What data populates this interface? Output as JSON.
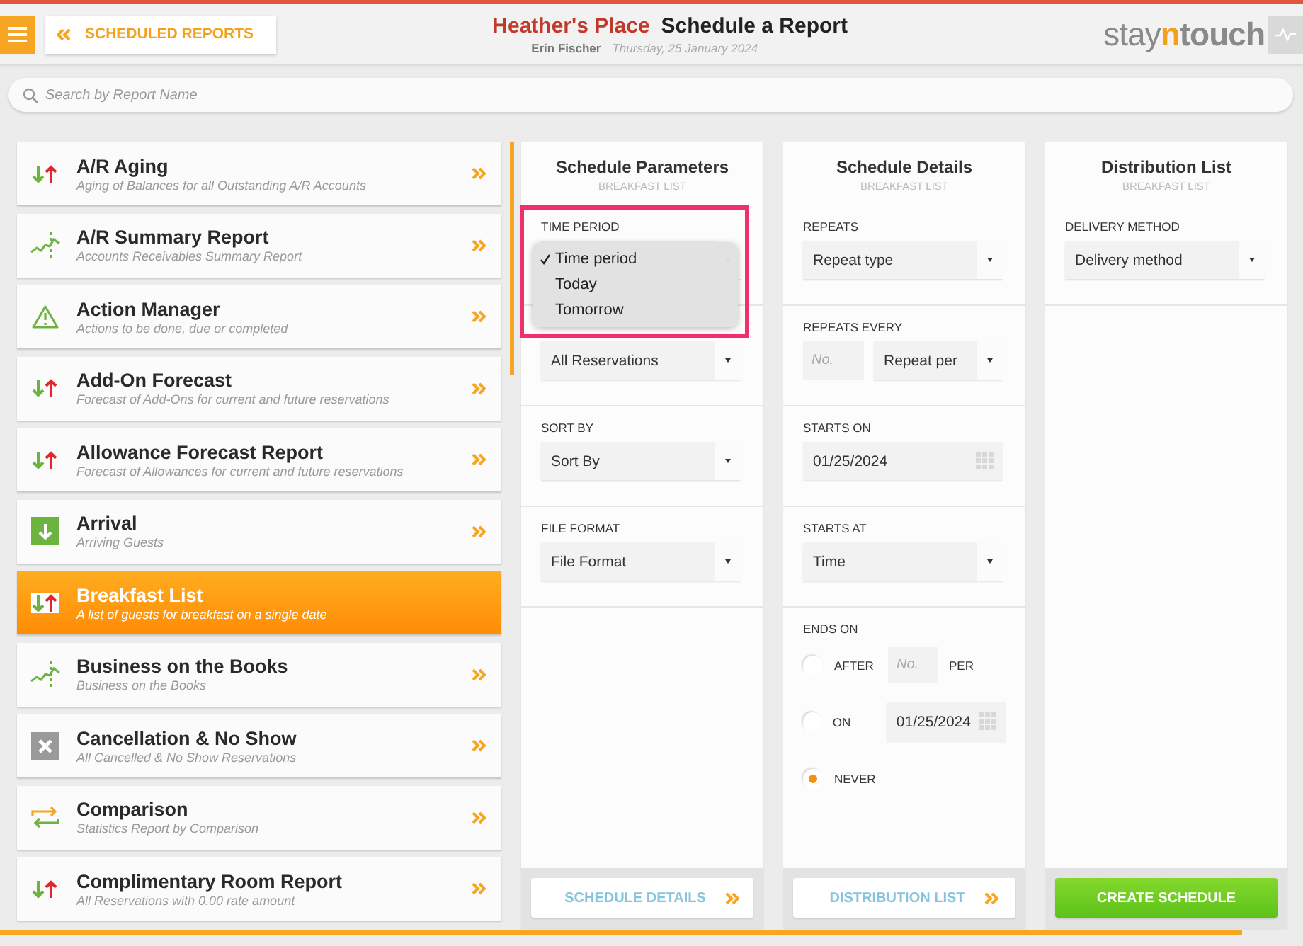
{
  "header": {
    "back_button": "SCHEDULED REPORTS",
    "hotel": "Heather's Place",
    "title": "Schedule a Report",
    "user": "Erin Fischer",
    "date": "Thursday, 25 January 2024",
    "logo": [
      "stay",
      "n",
      "touch"
    ]
  },
  "search": {
    "placeholder": "Search by Report Name"
  },
  "reports": [
    {
      "title": "A/R Aging",
      "subtitle": "Aging of Balances for all Outstanding A/R Accounts",
      "kind": "updown",
      "selected": false
    },
    {
      "title": "A/R Summary Report",
      "subtitle": "Accounts Receivables Summary Report",
      "kind": "trend",
      "selected": false
    },
    {
      "title": "Action Manager",
      "subtitle": "Actions to be done, due or completed",
      "kind": "warning",
      "selected": false
    },
    {
      "title": "Add-On Forecast",
      "subtitle": "Forecast of Add-Ons for current and future reservations",
      "kind": "updown",
      "selected": false
    },
    {
      "title": "Allowance Forecast Report",
      "subtitle": "Forecast of Allowances for current and future reservations",
      "kind": "updown",
      "selected": false
    },
    {
      "title": "Arrival",
      "subtitle": "Arriving Guests",
      "kind": "arrival",
      "selected": false
    },
    {
      "title": "Breakfast List",
      "subtitle": "A list of guests for breakfast on a single date",
      "kind": "updown",
      "selected": true
    },
    {
      "title": "Business on the Books",
      "subtitle": "Business on the Books",
      "kind": "trend",
      "selected": false
    },
    {
      "title": "Cancellation & No Show",
      "subtitle": "All Cancelled & No Show Reservations",
      "kind": "cross",
      "selected": false
    },
    {
      "title": "Comparison",
      "subtitle": "Statistics Report by Comparison",
      "kind": "compare",
      "selected": false
    },
    {
      "title": "Complimentary Room Report",
      "subtitle": "All Reservations with 0.00 rate amount",
      "kind": "updown",
      "selected": false
    }
  ],
  "panels": [
    {
      "title": "Schedule Parameters",
      "subtitle": "BREAKFAST LIST",
      "highlighted": true,
      "fields": [
        {
          "kind": "select",
          "label": "TIME PERIOD",
          "open": true,
          "options": [
            {
              "label": "Time period",
              "selected": true
            },
            {
              "label": "Today",
              "selected": false
            },
            {
              "label": "Tomorrow",
              "selected": false
            }
          ]
        },
        {
          "kind": "select",
          "value": "All Reservations"
        },
        {
          "kind": "select",
          "label": "SORT BY",
          "value": "Sort By"
        },
        {
          "kind": "select",
          "label": "FILE FORMAT",
          "value": "File Format"
        }
      ],
      "footer_button": {
        "kind": "next",
        "label": "SCHEDULE DETAILS"
      }
    },
    {
      "title": "Schedule Details",
      "subtitle": "BREAKFAST LIST",
      "highlighted": false,
      "fields": [
        {
          "kind": "select",
          "label": "REPEATS",
          "value": "Repeat type"
        },
        {
          "kind": "number_select",
          "label": "REPEATS EVERY",
          "placeholder": "No.",
          "value": "Repeat per"
        },
        {
          "kind": "date",
          "label": "STARTS ON",
          "value": "01/25/2024"
        },
        {
          "kind": "select",
          "label": "STARTS AT",
          "value": "Time"
        },
        {
          "kind": "radio_group",
          "label": "ENDS ON",
          "options": [
            {
              "label": "AFTER",
              "selected": false,
              "placeholder": "No.",
              "suffix": "PER"
            },
            {
              "label": "ON",
              "selected": false,
              "date": "01/25/2024"
            },
            {
              "label": "NEVER",
              "selected": true
            }
          ]
        }
      ],
      "footer_button": {
        "kind": "next",
        "label": "DISTRIBUTION LIST"
      }
    },
    {
      "title": "Distribution List",
      "subtitle": "BREAKFAST LIST",
      "highlighted": false,
      "fields": [
        {
          "kind": "select",
          "label": "DELIVERY METHOD",
          "value": "Delivery method"
        }
      ],
      "footer_button": {
        "kind": "primary",
        "label": "CREATE SCHEDULE"
      }
    }
  ]
}
